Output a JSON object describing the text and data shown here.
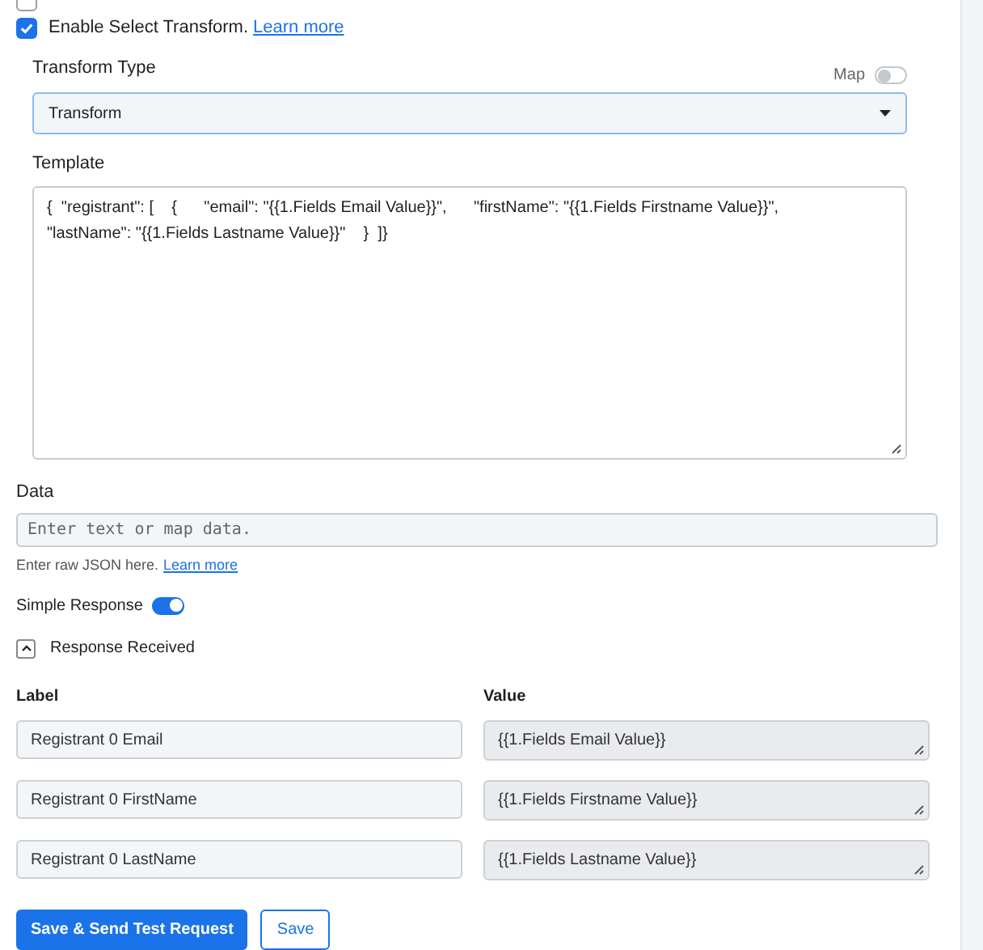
{
  "top_option": {
    "checked": false
  },
  "transform_option": {
    "checked": true,
    "label": "Enable Select Transform.",
    "link": "Learn more"
  },
  "transform_type": {
    "label": "Transform Type",
    "map_label": "Map",
    "map_on": false,
    "value": "Transform"
  },
  "template": {
    "label": "Template",
    "value": "{  \"registrant\": [    {      \"email\": \"{{1.Fields Email Value}}\",      \"firstName\": \"{{1.Fields Firstname Value}}\",      \"lastName\": \"{{1.Fields Lastname Value}}\"    }  ]}"
  },
  "data": {
    "label": "Data",
    "placeholder": "Enter text or map data.",
    "help": "Enter raw JSON here.",
    "link": "Learn more"
  },
  "simple_response": {
    "label": "Simple Response",
    "on": true
  },
  "response_received": {
    "label": "Response Received",
    "expanded": true
  },
  "columns": [
    "Label",
    "Value"
  ],
  "rows": [
    {
      "label": "Registrant 0 Email",
      "value": "{{1.Fields Email Value}}"
    },
    {
      "label": "Registrant 0 FirstName",
      "value": "{{1.Fields Firstname Value}}"
    },
    {
      "label": "Registrant 0 LastName",
      "value": "{{1.Fields Lastname Value}}"
    }
  ],
  "buttons": [
    "Save & Send Test Request",
    "Save"
  ]
}
